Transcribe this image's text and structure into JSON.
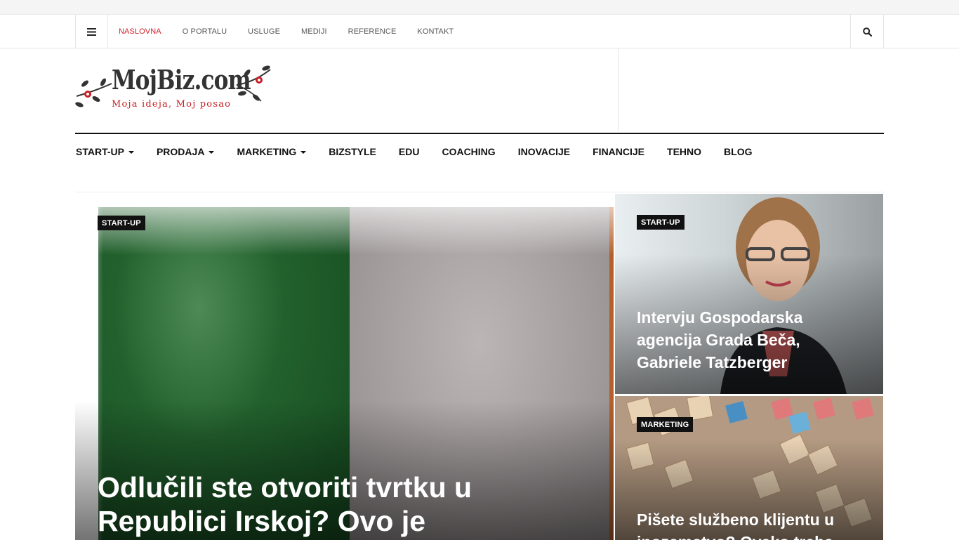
{
  "topbar": {
    "links": [
      {
        "label": "NASLOVNA",
        "active": true
      },
      {
        "label": "O PORTALU",
        "active": false
      },
      {
        "label": "USLUGE",
        "active": false
      },
      {
        "label": "MEDIJI",
        "active": false
      },
      {
        "label": "REFERENCE",
        "active": false
      },
      {
        "label": "KONTAKT",
        "active": false
      }
    ],
    "menu_icon": "hamburger-icon",
    "search_icon": "search-icon"
  },
  "logo": {
    "brand": "MojBiz.com",
    "tagline": "Moja ideja, Moj posao"
  },
  "mainnav": [
    {
      "label": "START-UP",
      "dropdown": true
    },
    {
      "label": "PRODAJA",
      "dropdown": true
    },
    {
      "label": "MARKETING",
      "dropdown": true
    },
    {
      "label": "BIZSTYLE",
      "dropdown": false
    },
    {
      "label": "EDU",
      "dropdown": false
    },
    {
      "label": "COACHING",
      "dropdown": false
    },
    {
      "label": "INOVACIJE",
      "dropdown": false
    },
    {
      "label": "FINANCIJE",
      "dropdown": false
    },
    {
      "label": "TEHNO",
      "dropdown": false
    },
    {
      "label": "BLOG",
      "dropdown": false
    }
  ],
  "featured": {
    "main": {
      "category": "START-UP",
      "title": "Odlučili ste otvoriti tvrtku u Republici Irskoj? Ovo je"
    },
    "side": [
      {
        "category": "START-UP",
        "title": "Intervju Gospodarska agencija Grada Beča, Gabriele Tatzberger"
      },
      {
        "category": "MARKETING",
        "title": "Pišete službeno klijentu u inozemstvo? Ovako treba"
      }
    ]
  },
  "colors": {
    "accent": "#d0202a",
    "nav_border": "#111111",
    "tag_bg": "#111111"
  }
}
